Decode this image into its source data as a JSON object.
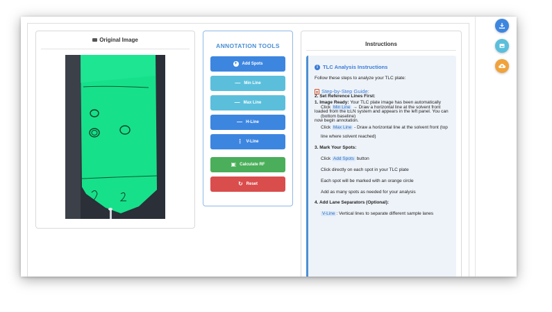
{
  "original_panel": {
    "title": "Original Image"
  },
  "tools": {
    "title": "ANNOTATION TOOLS",
    "add_spots": "Add Spots",
    "min_line": "Min Line",
    "max_line": "Max Line",
    "h_line": "H-Line",
    "v_line": "V-Line",
    "calculate_rf": "Calculate RF",
    "reset": "Reset"
  },
  "instructions": {
    "title": "Instructions",
    "heading": "TLC Analysis Instructions",
    "intro": "Follow these steps to analyze your TLC plate:",
    "guide_heading": "Step-by-Step Guide:",
    "step1_title": "1. Image Ready:",
    "step1_text": " Your TLC plate image has been automatically loaded from the ELN system and appears in the left panel. You can now begin annotation.",
    "step2_title": "2. Set Reference Lines First:",
    "step2_click": "Click ",
    "step2_min_tag": "Min Line",
    "step2_min_text": " → Draw a horizontal line at the solvent front (bottom baseline)",
    "step2_max_tag": "Max Line",
    "step2_max_text": "  - Draw a horizontal line at the solvent front (top line where solvent reached)",
    "step3_title": "3. Mark Your Spots:",
    "step3_click": "Click ",
    "step3_tag": "Add Spots",
    "step3_button": " button",
    "step3_line2": "Click directly on each spot in your TLC plate",
    "step3_line3": "Each spot will be marked with an orange circle",
    "step3_line4": "Add as many spots as needed for your analysis",
    "step4_title": "4. Add Lane Separators (Optional):",
    "step4_tag": "V-Line",
    "step4_text": ": Vertical lines to separate different sample lanes"
  },
  "icons": {
    "fab_download": "download-icon",
    "fab_image": "image-icon",
    "fab_upload": "cloud-upload-icon"
  },
  "colors": {
    "accent_blue": "#3d86e0",
    "cyan": "#5bbfdc",
    "green": "#4aae5a",
    "red": "#d94d4d",
    "orange": "#f0a33c",
    "plate_green": "#17e08a"
  }
}
